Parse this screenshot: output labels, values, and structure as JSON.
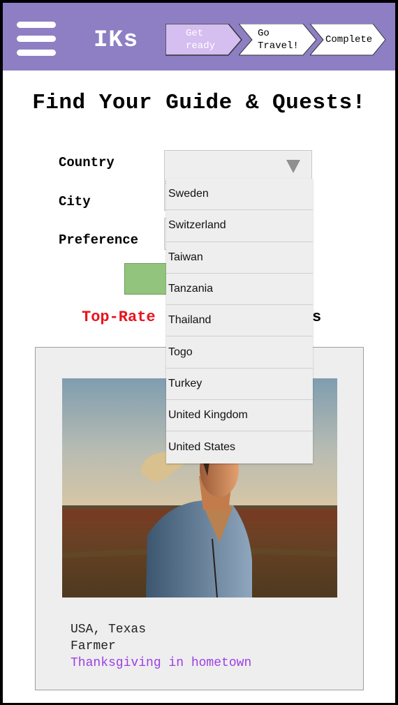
{
  "header": {
    "brand": "IKs",
    "steps": [
      {
        "label": "Get\nready",
        "fill": "#d5bef0",
        "text_color": "#ffffff"
      },
      {
        "label": "Go\nTravel!",
        "fill": "#ffffff",
        "text_color": "#000000"
      },
      {
        "label": "Complete",
        "fill": "#ffffff",
        "text_color": "#000000"
      }
    ]
  },
  "page": {
    "title": "Find Your Guide & Quests!"
  },
  "form": {
    "country_label": "Country",
    "city_label": "City",
    "preference_label": "Preference",
    "country_options": [
      "Sweden",
      "Switzerland",
      "Taiwan",
      "Tanzania",
      "Thailand",
      "Togo",
      "Turkey",
      "United Kingdom",
      "United States"
    ]
  },
  "top_rated": {
    "visible_start": "Top-Rate",
    "visible_end": "s"
  },
  "card": {
    "location": "USA, Texas",
    "occupation": "Farmer",
    "quest": "Thanksgiving in hometown"
  },
  "colors": {
    "header_bg": "#8e7fc4",
    "accent_red": "#e8141e",
    "quest_purple": "#9b3fe6",
    "search_green": "#93c47d"
  }
}
